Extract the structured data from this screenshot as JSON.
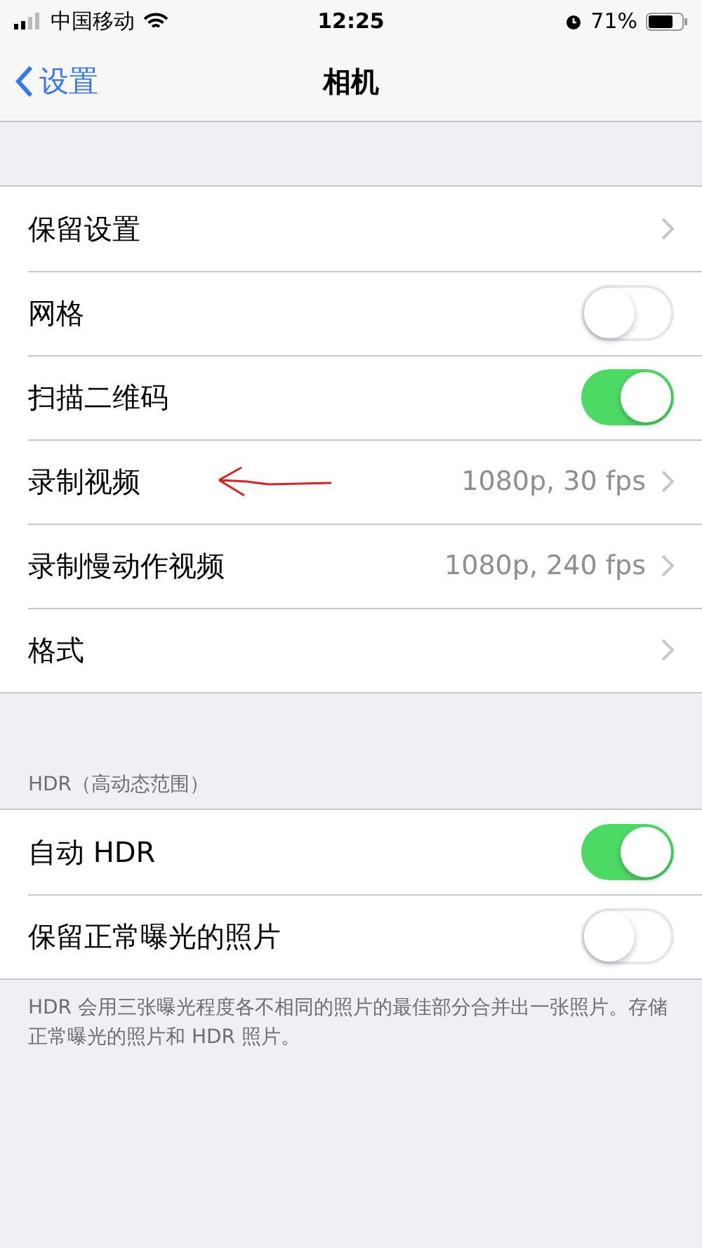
{
  "status_bar": {
    "carrier": "中国移动",
    "time": "12:25",
    "battery": "71%"
  },
  "nav": {
    "back": "设置",
    "title": "相机"
  },
  "groups": [
    {
      "rows": [
        {
          "kind": "link",
          "label": "保留设置"
        },
        {
          "kind": "toggle",
          "label": "网格",
          "on": false
        },
        {
          "kind": "toggle",
          "label": "扫描二维码",
          "on": true
        },
        {
          "kind": "link",
          "label": "录制视频",
          "value": "1080p, 30 fps",
          "marked": true
        },
        {
          "kind": "link",
          "label": "录制慢动作视频",
          "value": "1080p, 240 fps"
        },
        {
          "kind": "link",
          "label": "格式"
        }
      ]
    },
    {
      "header": "HDR（高动态范围）",
      "rows": [
        {
          "kind": "toggle",
          "label": "自动 HDR",
          "on": true
        },
        {
          "kind": "toggle",
          "label": "保留正常曝光的照片",
          "on": false
        }
      ],
      "footer": "HDR 会用三张曝光程度各不相同的照片的最佳部分合并出一张照片。存储正常曝光的照片和 HDR 照片。"
    }
  ]
}
